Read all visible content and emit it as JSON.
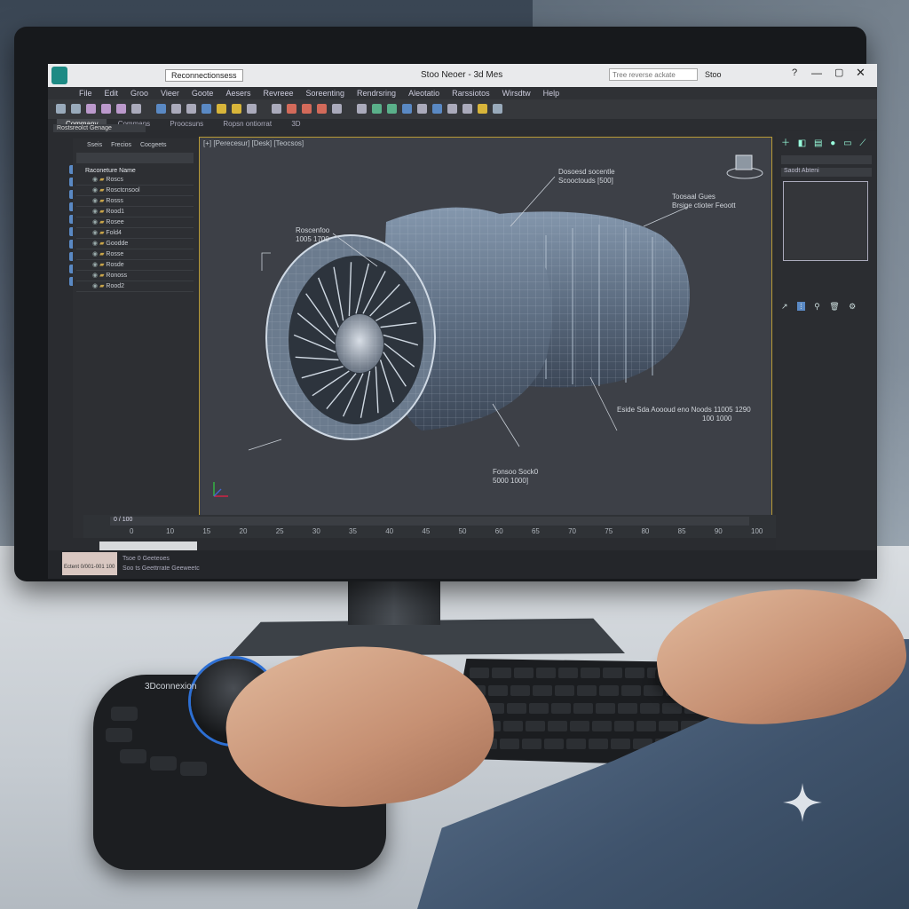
{
  "app": {
    "title_tab": "Reconnectionsess",
    "window_title": "Stoo Neoer - 3d Mes",
    "search_placeholder": "Tree reverse ackate",
    "search_button": "Stoo",
    "help_icon": "question-icon"
  },
  "menu": [
    "File",
    "Edit",
    "Groo",
    "Vieer",
    "Goote",
    "Aesers",
    "Revreee",
    "Soreenting",
    "Rendrsring",
    "Aleotatio",
    "Rarssiotos",
    "Wirsdtw",
    "Help"
  ],
  "ribbon": {
    "tabs": [
      "Commany",
      "Commans",
      "Proocsuns",
      "Ropsn ontiorrat",
      "3D"
    ]
  },
  "explorer": {
    "subtitle": "Rostsreolct Genage",
    "tabs": [
      "Sseis",
      "Frecios",
      "Cocgeets"
    ],
    "header": "Raconeture Name",
    "rows": [
      "Roscs",
      "Rosctcnsool",
      "Rosss",
      "Rood1",
      "Rosee",
      "Fold4",
      "Goodde",
      "Rosse",
      "Rosde",
      "Ronoss",
      "Rood2"
    ]
  },
  "viewport": {
    "label": "[+] [Perecesur] [Desk] [Teocsos]",
    "callouts": [
      {
        "line1": "Roscenfoo",
        "line2": "1005 1700"
      },
      {
        "line1": "Dosoesd socentle",
        "line2": "Scooctouds    [500]"
      },
      {
        "line1": "Toosaal Gues",
        "line2": "Brsige ctioter Feoott"
      },
      {
        "line1": "Eside Sda Aoooud eno Noods 11005 1290",
        "line2": "100 1000"
      },
      {
        "line1": "Fonsoo Sock0",
        "line2": "5000 1000]"
      }
    ]
  },
  "command_panel": {
    "dropdown": "Saodt Abteni"
  },
  "timeline": {
    "counter": "0 / 100",
    "ticks": [
      "0",
      "10",
      "15",
      "20",
      "25",
      "30",
      "35",
      "40",
      "45",
      "50",
      "60",
      "65",
      "70",
      "75",
      "80",
      "85",
      "90",
      "100"
    ]
  },
  "status": {
    "coords": "Ectent 0/001-001 100",
    "line1": "Tsoe 0 Geeteoes",
    "line2": "Soo ts Geettrrate Geeweetc"
  },
  "device": {
    "brand": "3Dconnexion"
  },
  "colors": {
    "viewport_border": "#b89a36",
    "wire": "#9fb3c8",
    "accent_blue": "#2d6fd3"
  }
}
